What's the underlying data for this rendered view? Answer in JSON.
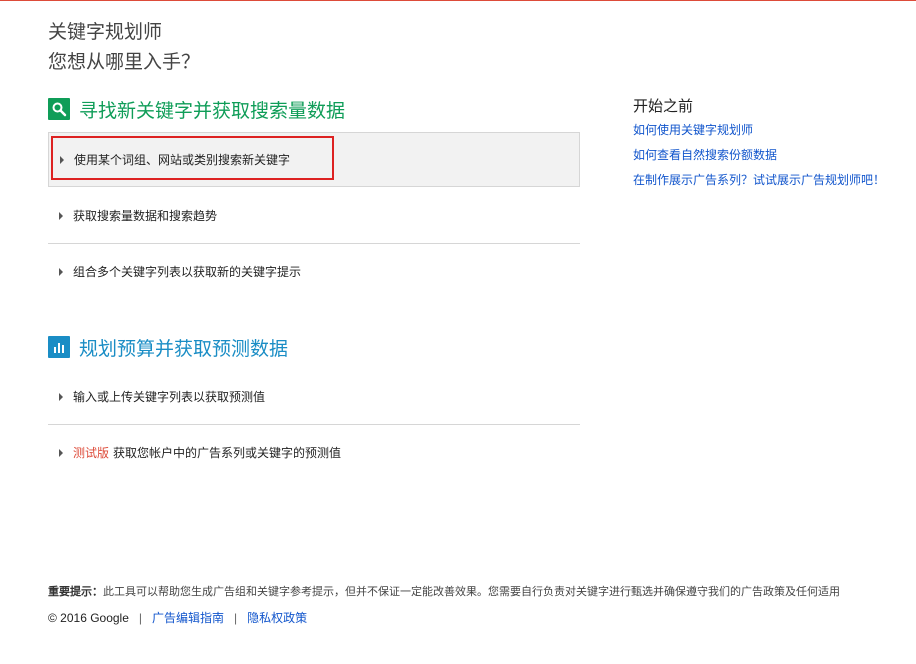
{
  "header": {
    "title": "关键字规划师",
    "subtitle": "您想从哪里入手？"
  },
  "sections": [
    {
      "title": "寻找新关键字并获取搜索量数据",
      "icon": "search-icon",
      "color": "#0f9d58",
      "options": [
        {
          "label": "使用某个词组、网站或类别搜索新关键字",
          "selected": true
        },
        {
          "label": "获取搜索量数据和搜索趋势"
        },
        {
          "label": "组合多个关键字列表以获取新的关键字提示"
        }
      ]
    },
    {
      "title": "规划预算并获取预测数据",
      "icon": "bar-chart-icon",
      "color": "#1a8dc5",
      "options": [
        {
          "label": "输入或上传关键字列表以获取预测值"
        },
        {
          "beta": "测试版",
          "label": "获取您帐户中的广告系列或关键字的预测值"
        }
      ]
    }
  ],
  "sidebar": {
    "title": "开始之前",
    "links": [
      "如何使用关键字规划师",
      "如何查看自然搜索份额数据",
      "在制作展示广告系列？试试展示广告规划师吧！"
    ]
  },
  "notice": {
    "label": "重要提示：",
    "text": "此工具可以帮助您生成广告组和关键字参考提示，但并不保证一定能改善效果。您需要自行负责对关键字进行甄选并确保遵守我们的广告政策及任何适用"
  },
  "footer": {
    "copyright": "© 2016 Google",
    "separator": "|",
    "links": [
      "广告编辑指南",
      "隐私权政策"
    ]
  },
  "colors": {
    "accent_link": "#1155cc",
    "highlight_border": "#dd2222",
    "beta": "#dd4b39"
  }
}
